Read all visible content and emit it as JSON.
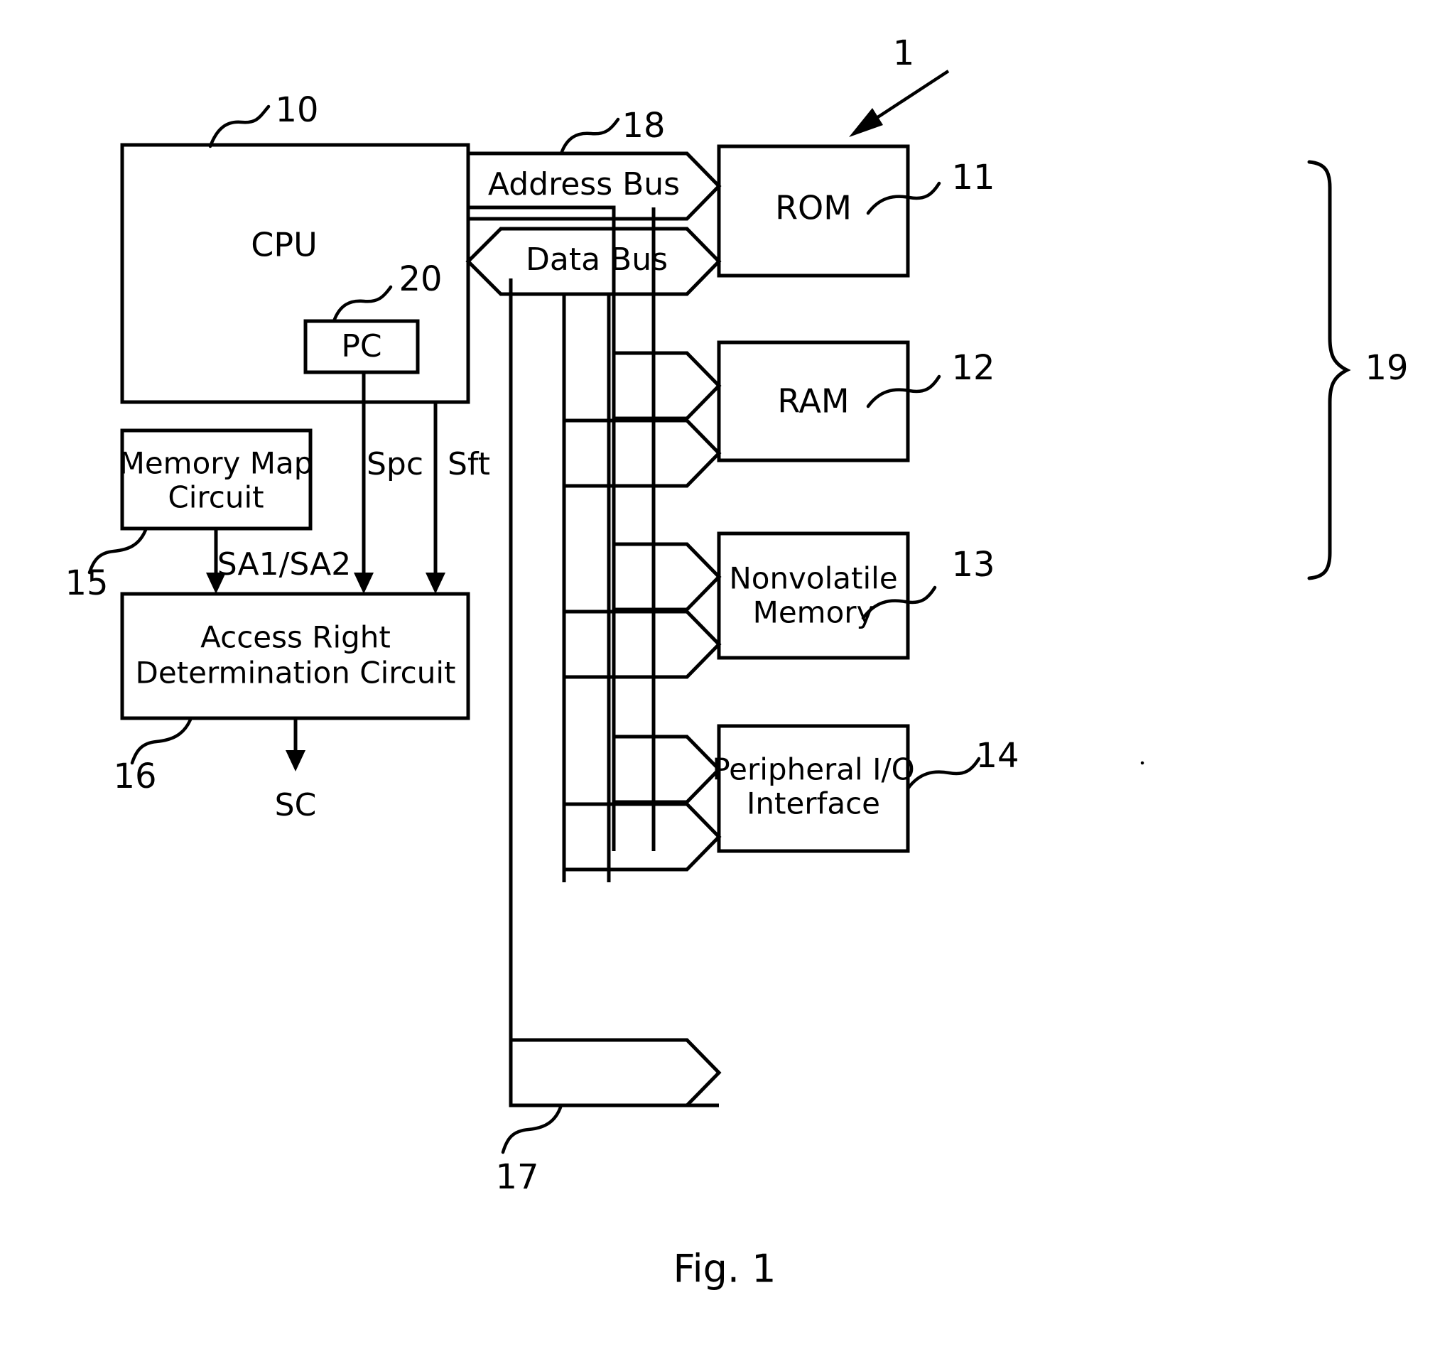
{
  "figure": {
    "caption": "Fig. 1",
    "system_ref": "1"
  },
  "blocks": {
    "cpu": {
      "label": "CPU",
      "ref": "10"
    },
    "pc": {
      "label": "PC",
      "ref": "20"
    },
    "memory_map": {
      "label_line1": "Memory Map",
      "label_line2": "Circuit",
      "ref": "15"
    },
    "access": {
      "label_line1": "Access Right",
      "label_line2": "Determination Circuit",
      "ref": "16"
    },
    "rom": {
      "label": "ROM",
      "ref": "11"
    },
    "ram": {
      "label": "RAM",
      "ref": "12"
    },
    "nvm": {
      "label_line1": "Nonvolatile",
      "label_line2": "Memory",
      "ref": "13"
    },
    "periph": {
      "label_line1": "Peripheral I/O",
      "label_line2": "Interface",
      "ref": "14"
    }
  },
  "buses": {
    "address": {
      "label": "Address Bus",
      "ref": "18"
    },
    "data": {
      "label": "Data Bus",
      "ref": "17"
    }
  },
  "signals": {
    "spc": "Spc",
    "sft": "Sft",
    "sa": "SA1/SA2",
    "sc": "SC"
  },
  "group": {
    "peripherals_ref": "19"
  },
  "colors": {
    "line": "#000000",
    "background": "#ffffff",
    "text": "#000000"
  }
}
